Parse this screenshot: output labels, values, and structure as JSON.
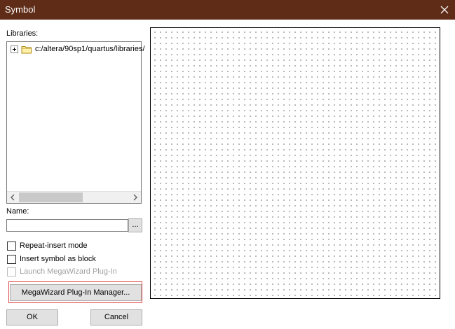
{
  "window": {
    "title": "Symbol",
    "close_icon": "close-icon"
  },
  "libraries": {
    "label": "Libraries:",
    "tree": [
      {
        "label": "c:/altera/90sp1/quartus/libraries/",
        "icon": "folder-icon",
        "expanded": false
      }
    ]
  },
  "name": {
    "label": "Name:",
    "value": "",
    "browse_label": "..."
  },
  "options": {
    "repeat_insert": {
      "label": "Repeat-insert mode",
      "checked": false
    },
    "insert_as_block": {
      "label": "Insert symbol as block",
      "checked": false
    },
    "launch_megawizard": {
      "label": "Launch MegaWizard Plug-In",
      "checked": false,
      "disabled": true
    }
  },
  "buttons": {
    "megawizard": "MegaWizard Plug-In Manager...",
    "ok": "OK",
    "cancel": "Cancel"
  },
  "colors": {
    "titlebar": "#5e2c17",
    "highlight": "#e05050"
  }
}
